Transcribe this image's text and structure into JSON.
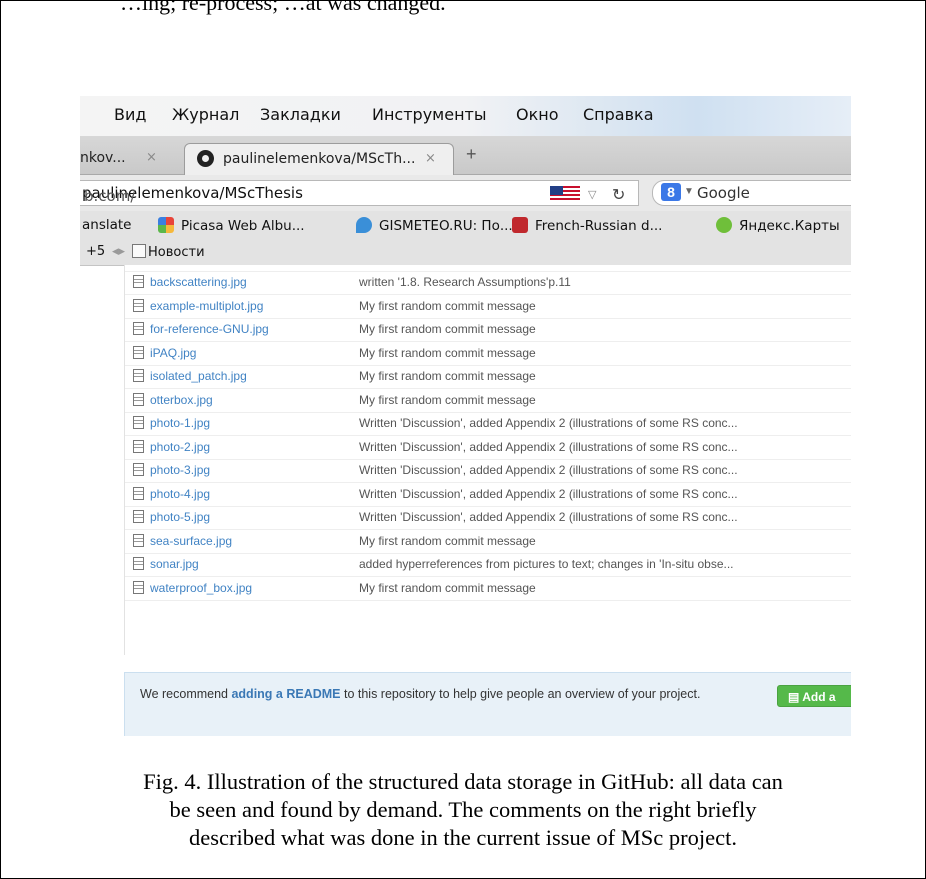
{
  "top_cut_text": "…ing; re-process; …at was changed.",
  "menu": [
    "Вид",
    "Журнал",
    "Закладки",
    "Инструменты",
    "Окно",
    "Справка"
  ],
  "tabs": {
    "inactive_label": "nkov...",
    "active_label": "paulinelemenkova/MScTh...",
    "close_glyph": "×",
    "new_tab_glyph": "+"
  },
  "url": {
    "host": "b.com/",
    "path": "paulinelemenkova/MScThesis"
  },
  "search": {
    "engine_label": "Google",
    "badge": "8"
  },
  "bookmarks": [
    {
      "label": "anslate",
      "color": "#ffffff"
    },
    {
      "label": "Picasa Web Albu...",
      "color": "#e8a23a"
    },
    {
      "label": "GISMETEO.RU: По...",
      "color": "#3a8fd8"
    },
    {
      "label": "French-Russian d...",
      "color": "#c0282d"
    },
    {
      "label": "Яндекс.Карты",
      "color": "#6fbf3a"
    }
  ],
  "bookmarks2": {
    "more": "+5",
    "news": "Новости"
  },
  "files": [
    {
      "name": "backscattering.jpg",
      "message": "written '1.8. Research Assumptions'p.11"
    },
    {
      "name": "example-multiplot.jpg",
      "message": "My first random commit message"
    },
    {
      "name": "for-reference-GNU.jpg",
      "message": "My first random commit message"
    },
    {
      "name": "iPAQ.jpg",
      "message": "My first random commit message"
    },
    {
      "name": "isolated_patch.jpg",
      "message": "My first random commit message"
    },
    {
      "name": "otterbox.jpg",
      "message": "My first random commit message"
    },
    {
      "name": "photo-1.jpg",
      "message": "Written 'Discussion', added Appendix 2 (illustrations of some RS conc..."
    },
    {
      "name": "photo-2.jpg",
      "message": "Written 'Discussion', added Appendix 2 (illustrations of some RS conc..."
    },
    {
      "name": "photo-3.jpg",
      "message": "Written 'Discussion', added Appendix 2 (illustrations of some RS conc..."
    },
    {
      "name": "photo-4.jpg",
      "message": "Written 'Discussion', added Appendix 2 (illustrations of some RS conc..."
    },
    {
      "name": "photo-5.jpg",
      "message": "Written 'Discussion', added Appendix 2 (illustrations of some RS conc..."
    },
    {
      "name": "sea-surface.jpg",
      "message": "My first random commit message"
    },
    {
      "name": "sonar.jpg",
      "message": "added hyperreferences from pictures to text; changes in 'In-situ obse..."
    },
    {
      "name": "waterproof_box.jpg",
      "message": "My first random commit message"
    }
  ],
  "readme": {
    "text_before": "We recommend ",
    "link": "adding a README",
    "text_after": " to this repository to help give people an overview of your project.",
    "button_label": "Add a"
  },
  "caption": [
    "Fig. 4. Illustration of the structured data storage in GitHub: all data can",
    "be seen and found by demand. The comments on the right briefly",
    "described what was done in the current issue of MSc project."
  ]
}
